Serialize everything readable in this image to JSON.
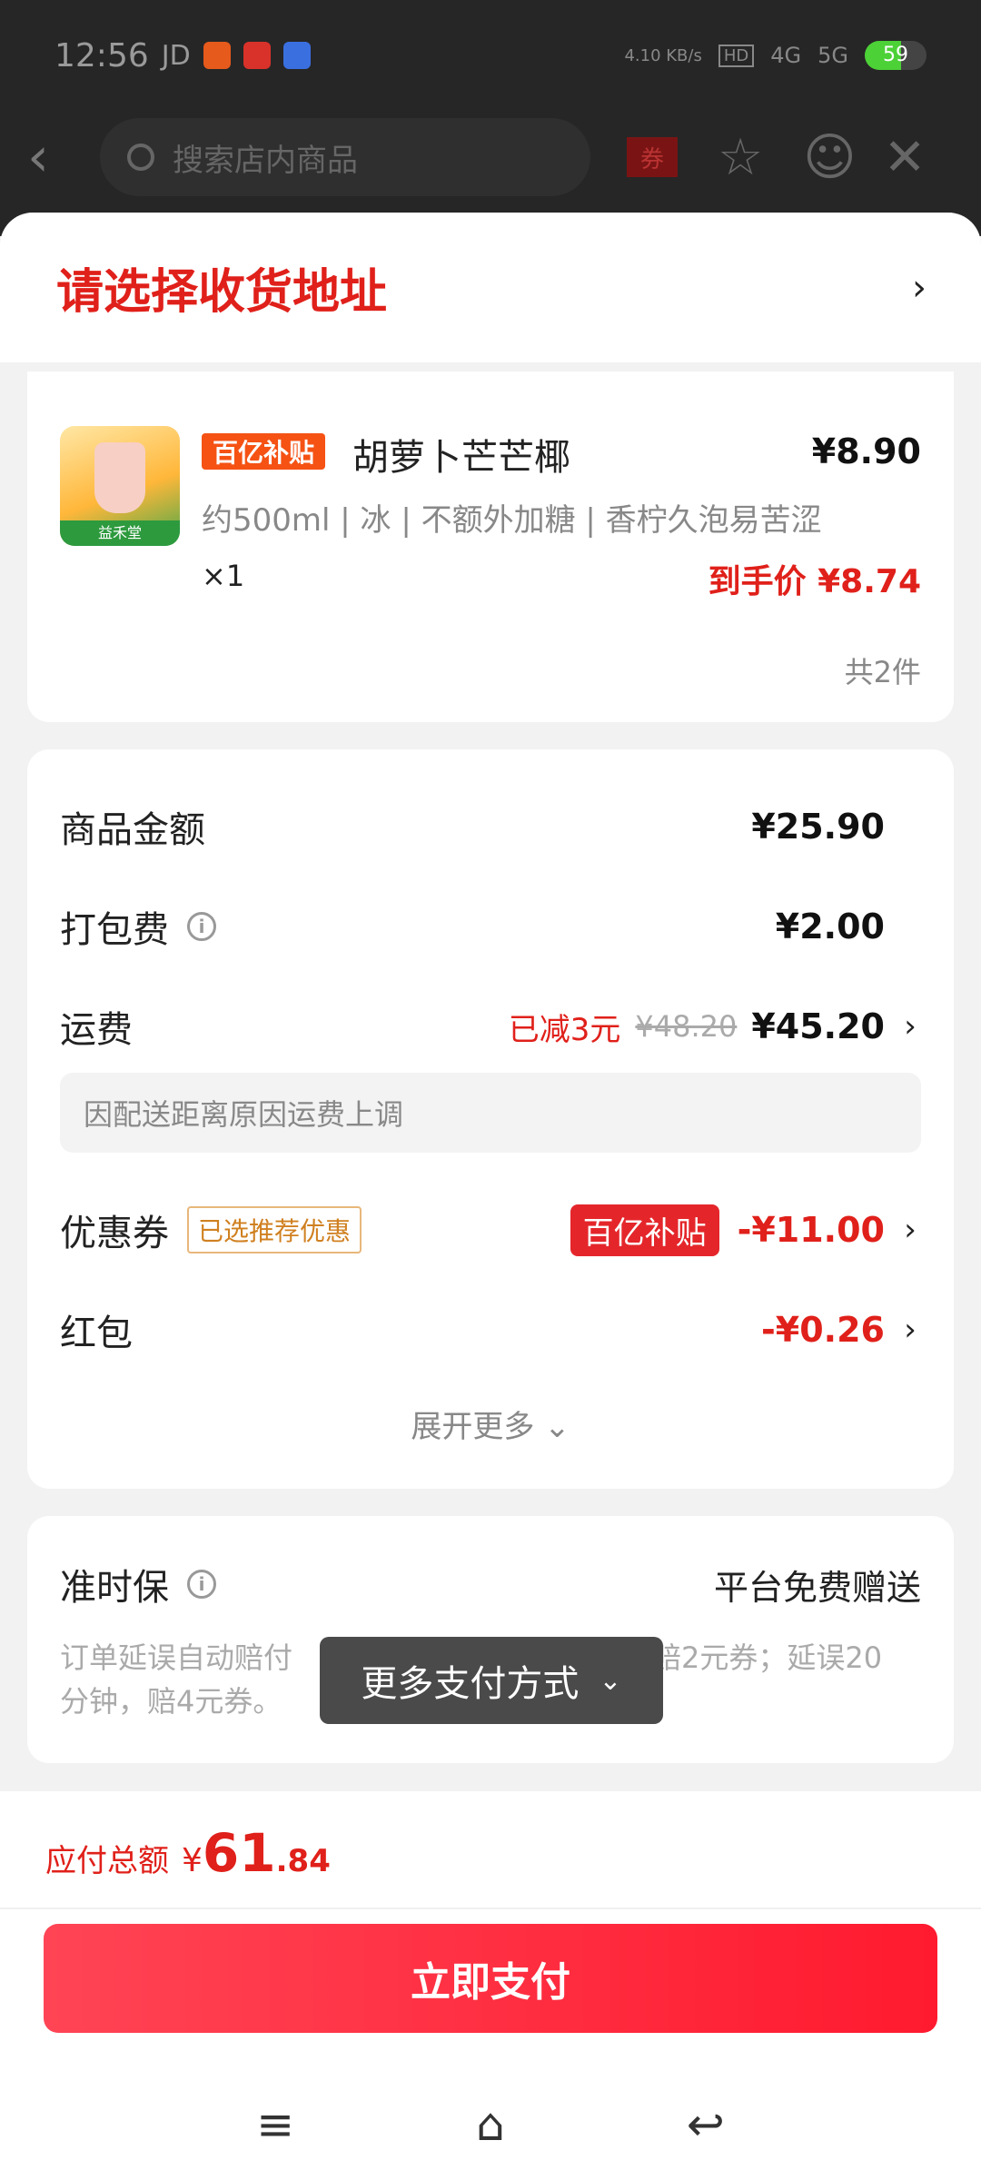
{
  "status_bar": {
    "time": "12:56",
    "carrier": "JD",
    "net_speed": "4.10 KB/s",
    "sig1": "4G",
    "sig2": "5G",
    "battery": "59",
    "battery_level": 0.59
  },
  "top_nav": {
    "search_placeholder": "搜索店内商品",
    "coupon_label": "券"
  },
  "address": {
    "title": "请选择收货地址"
  },
  "goods": {
    "badge": "百亿补贴",
    "name": "胡萝卜芒芒椰",
    "price": "¥8.90",
    "spec": "约500ml | 冰 | 不额外加糖 | 香柠久泡易苦涩",
    "qty": "×1",
    "final_price": "到手价 ¥8.74",
    "total_count": "共2件",
    "thumb_brand": "益禾堂"
  },
  "fees": {
    "goods_amount": {
      "label": "商品金额",
      "value": "¥25.90"
    },
    "packing": {
      "label": "打包费",
      "value": "¥2.00"
    },
    "shipping": {
      "label": "运费",
      "reduced": "已减3元",
      "original": "¥48.20",
      "value": "¥45.20"
    },
    "notice": "因配送距离原因运费上调",
    "coupon": {
      "label": "优惠券",
      "chosen_tag": "已选推荐优惠",
      "sub_tag": "百亿补贴",
      "value": "-¥11.00"
    },
    "red_packet": {
      "label": "红包",
      "value": "-¥0.26"
    },
    "expand": "展开更多 ⌄"
  },
  "ontime": {
    "label": "准时保",
    "value": "平台免费赠送",
    "desc_start": "订单延误自动赔付",
    "desc_end": "赔2元券；延误20分钟，赔4元券。"
  },
  "toast": {
    "label": "更多支付方式"
  },
  "total": {
    "label": "应付总额",
    "currency": "¥",
    "integer": "61",
    "decimal": ".84"
  },
  "pay": {
    "button": "立即支付"
  },
  "colors": {
    "accent_red": "#e0201a",
    "pay_button": "#ff1a2f"
  }
}
